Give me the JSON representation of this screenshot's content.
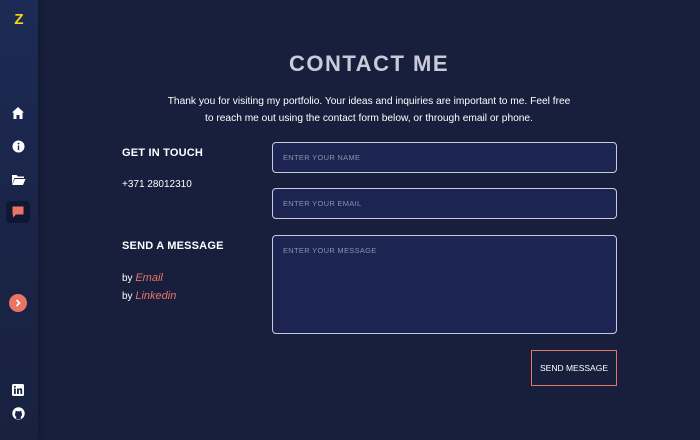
{
  "sidebar": {
    "logo": "Z",
    "nav": [
      {
        "name": "home",
        "icon": "home-icon"
      },
      {
        "name": "about",
        "icon": "info-icon"
      },
      {
        "name": "projects",
        "icon": "folder-icon"
      },
      {
        "name": "contact",
        "icon": "message-icon",
        "active": true
      }
    ],
    "expand_icon": "chevron-right-icon",
    "social": [
      {
        "name": "linkedin",
        "icon": "linkedin-icon"
      },
      {
        "name": "github",
        "icon": "github-icon"
      }
    ]
  },
  "main": {
    "title": "CONTACT ME",
    "intro": "Thank you for visiting my portfolio. Your ideas and inquiries are important to me. Feel free to reach me out using the contact form below, or through email or phone.",
    "get_in_touch": "GET IN TOUCH",
    "phone": "+371 28012310",
    "send_a_message": "SEND A MESSAGE",
    "links": [
      {
        "prefix": "by",
        "label": "Email"
      },
      {
        "prefix": "by",
        "label": "Linkedin"
      }
    ],
    "form": {
      "name_placeholder": "ENTER YOUR NAME",
      "email_placeholder": "ENTER YOUR EMAIL",
      "message_placeholder": "ENTER YOUR MESSAGE",
      "submit_label": "SEND MESSAGE"
    }
  },
  "colors": {
    "background": "#171f3d",
    "sidebar": "#1c2a55",
    "accent": "#e87466",
    "logo": "#f5d90a",
    "field_bg": "#1c2551",
    "title": "#c9ccd8"
  }
}
